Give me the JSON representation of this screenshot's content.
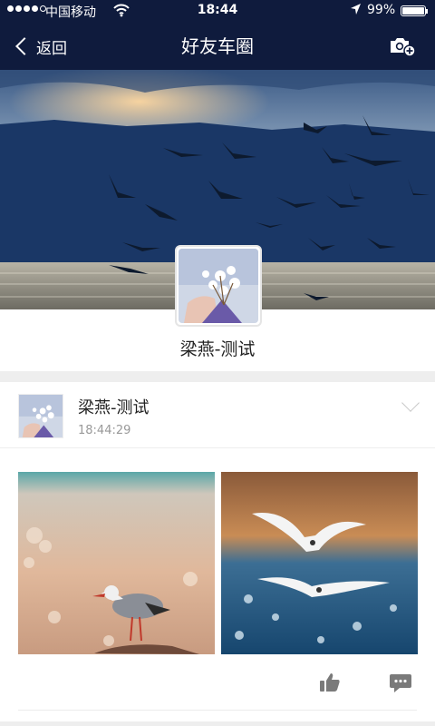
{
  "status_bar": {
    "carrier": "中国移动",
    "time": "18:44",
    "battery": "99%",
    "battery_level": 0.99,
    "signal_bars": 4,
    "icons": [
      "signal-dots-icon",
      "wifi-icon",
      "location-arrow-icon",
      "battery-icon"
    ]
  },
  "nav": {
    "back_label": "返回",
    "title": "好友车圈",
    "icons": [
      "back-chevron-icon",
      "camera-plus-icon"
    ]
  },
  "profile": {
    "name": "梁燕-测试",
    "cover_image": "dusk sky with flock of birds over the sea",
    "avatar_image": "hand holding white cherry blossoms"
  },
  "post": {
    "author": "梁燕-测试",
    "time": "18:44:29",
    "photos": [
      {
        "description": "seagull standing on a rock at the sea shore"
      },
      {
        "description": "two seagulls flying over the sea"
      }
    ],
    "actions": [
      "like-icon",
      "comment-icon"
    ],
    "menu_icon": "chevron-down-icon"
  },
  "colors": {
    "nav_background": "#0f1b3d",
    "section_gap": "#eeeeee",
    "time_text": "#999999"
  }
}
